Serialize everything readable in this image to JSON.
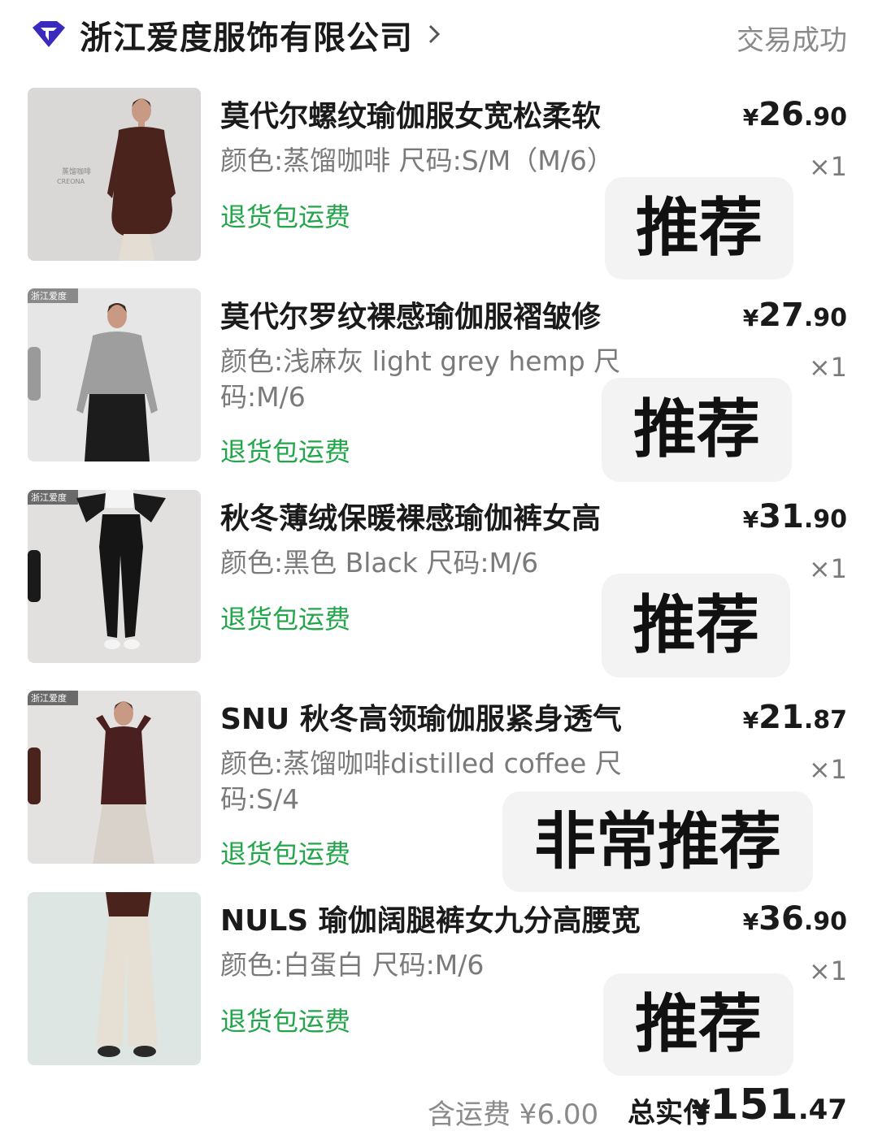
{
  "header": {
    "shop_name": "浙江爱度服饰有限公司",
    "status": "交易成功",
    "brand_color": "#3a2bbd"
  },
  "items": [
    {
      "title": "莫代尔螺纹瑜伽服女宽松柔软",
      "spec": "颜色:蒸馏咖啡 尺码:S/M（M/6）",
      "refund": "退货包运费",
      "price_currency": "¥",
      "price_int": "26",
      "price_dec": ".90",
      "qty": "×1",
      "tag": "推荐",
      "thumb_label": "蒸馏咖啡\nCREONA"
    },
    {
      "title": "莫代尔罗纹裸感瑜伽服褶皱修",
      "spec": "颜色:浅麻灰 light grey hemp 尺码:M/6",
      "refund": "退货包运费",
      "price_currency": "¥",
      "price_int": "27",
      "price_dec": ".90",
      "qty": "×1",
      "tag": "推荐",
      "thumb_label": "浙江爱度"
    },
    {
      "title": "秋冬薄绒保暖裸感瑜伽裤女高",
      "spec": "颜色:黑色 Black 尺码:M/6",
      "refund": "退货包运费",
      "price_currency": "¥",
      "price_int": "31",
      "price_dec": ".90",
      "qty": "×1",
      "tag": "推荐",
      "thumb_label": "浙江爱度"
    },
    {
      "title": "SNU 秋冬高领瑜伽服紧身透气",
      "spec": "颜色:蒸馏咖啡distilled coffee 尺码:S/4",
      "refund": "退货包运费",
      "price_currency": "¥",
      "price_int": "21",
      "price_dec": ".87",
      "qty": "×1",
      "tag": "非常推荐",
      "thumb_label": "浙江爱度"
    },
    {
      "title": "NULS 瑜伽阔腿裤女九分高腰宽",
      "spec": "颜色:白蛋白 尺码:M/6",
      "refund": "退货包运费",
      "price_currency": "¥",
      "price_int": "36",
      "price_dec": ".90",
      "qty": "×1",
      "tag": "推荐",
      "thumb_label": ""
    }
  ],
  "footer": {
    "shipping": "含运费 ¥6.00",
    "total_label": "总实付",
    "total_currency": "¥",
    "total_int": "151",
    "total_dec": ".47"
  },
  "colors": {
    "refund_green": "#22a64a",
    "muted_text": "#7a7a7a",
    "tag_bg": "#f3f3f3"
  }
}
